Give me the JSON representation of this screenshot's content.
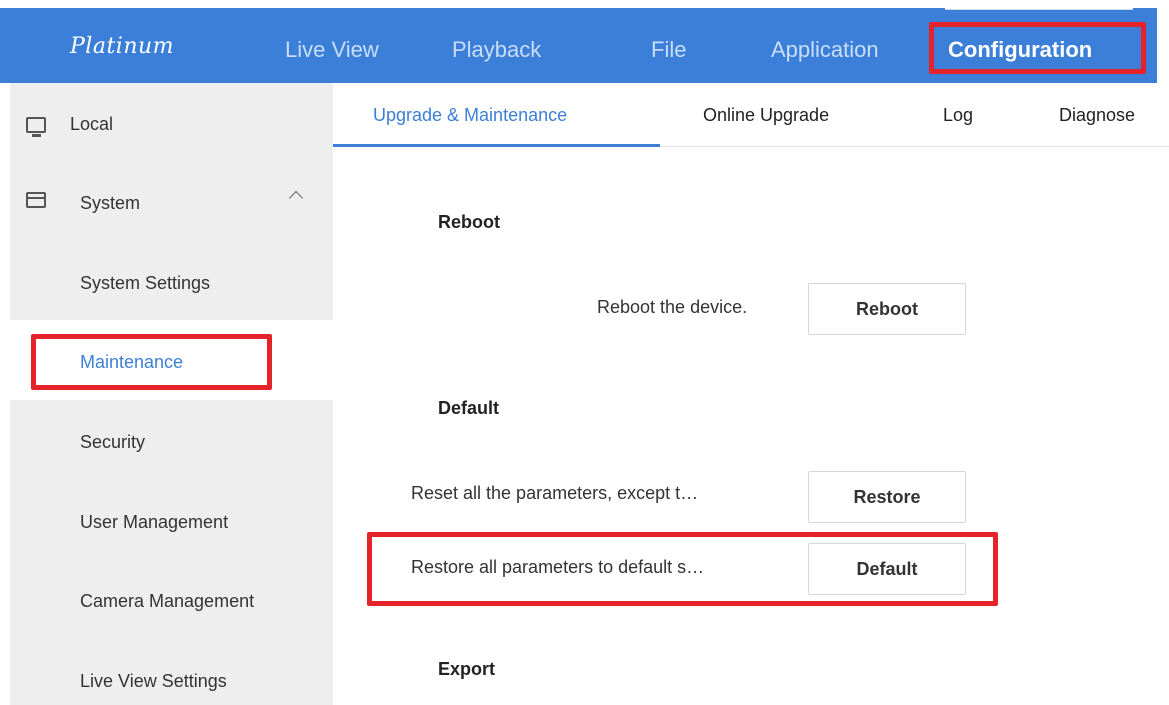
{
  "header": {
    "logo": "Platinum",
    "nav": [
      "Live View",
      "Playback",
      "File",
      "Application",
      "Configuration"
    ],
    "active_nav": "Configuration"
  },
  "sidebar": {
    "items": [
      {
        "label": "Local",
        "icon": "monitor-icon"
      },
      {
        "label": "System",
        "icon": "window-icon",
        "expanded": true
      },
      {
        "label": "System Settings"
      },
      {
        "label": "Maintenance",
        "selected": true
      },
      {
        "label": "Security"
      },
      {
        "label": "User Management"
      },
      {
        "label": "Camera Management"
      },
      {
        "label": "Live View Settings"
      }
    ]
  },
  "tabs": {
    "items": [
      "Upgrade & Maintenance",
      "Online Upgrade",
      "Log",
      "Diagnose"
    ],
    "active": "Upgrade & Maintenance"
  },
  "main": {
    "reboot": {
      "title": "Reboot",
      "description": "Reboot the device.",
      "button": "Reboot"
    },
    "default": {
      "title": "Default",
      "restore_description": "Reset all the parameters, except t…",
      "restore_button": "Restore",
      "default_description": "Restore all parameters to default s…",
      "default_button": "Default"
    },
    "export": {
      "title": "Export"
    }
  },
  "colors": {
    "topbar": "#3c7fd8",
    "accent": "#3c7fd8",
    "highlight": "#e4232a",
    "sidebar_bg": "#eeeeee"
  }
}
